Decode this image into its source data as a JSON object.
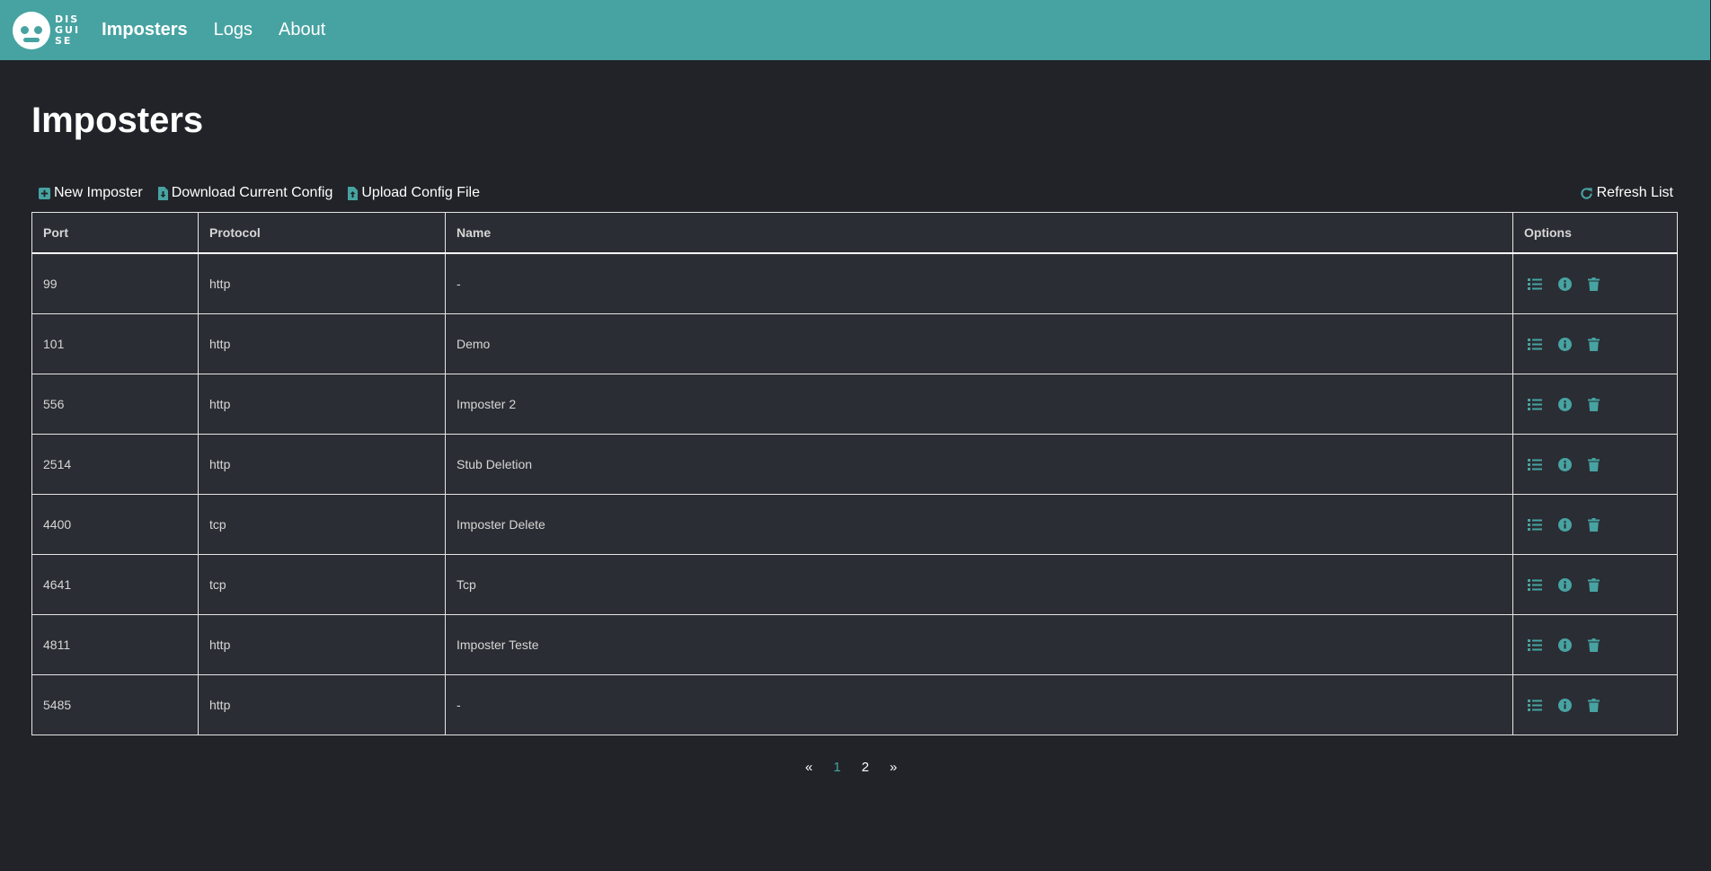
{
  "app": {
    "logo_text": [
      "DIS",
      "GUI",
      "SE"
    ],
    "brand_color": "#47a3a2",
    "background": "#212328"
  },
  "nav": {
    "items": [
      {
        "label": "Imposters",
        "active": true
      },
      {
        "label": "Logs",
        "active": false
      },
      {
        "label": "About",
        "active": false
      }
    ]
  },
  "page": {
    "title": "Imposters"
  },
  "toolbar": {
    "new_label": "New Imposter",
    "new_icon": "plus-square-icon",
    "download_label": "Download Current Config",
    "download_icon": "file-download-icon",
    "upload_label": "Upload Config File",
    "upload_icon": "file-upload-icon",
    "refresh_label": "Refresh List",
    "refresh_icon": "refresh-icon"
  },
  "table": {
    "headers": {
      "port": "Port",
      "protocol": "Protocol",
      "name": "Name",
      "options": "Options"
    },
    "option_icons": [
      "list-icon",
      "info-circle-icon",
      "trash-icon"
    ],
    "rows": [
      {
        "port": "99",
        "protocol": "http",
        "name": "-"
      },
      {
        "port": "101",
        "protocol": "http",
        "name": "Demo"
      },
      {
        "port": "556",
        "protocol": "http",
        "name": "Imposter 2"
      },
      {
        "port": "2514",
        "protocol": "http",
        "name": "Stub Deletion"
      },
      {
        "port": "4400",
        "protocol": "tcp",
        "name": "Imposter Delete"
      },
      {
        "port": "4641",
        "protocol": "tcp",
        "name": "Tcp"
      },
      {
        "port": "4811",
        "protocol": "http",
        "name": "Imposter Teste"
      },
      {
        "port": "5485",
        "protocol": "http",
        "name": "-"
      }
    ]
  },
  "pagination": {
    "prev": "«",
    "pages": [
      "1",
      "2"
    ],
    "current": "1",
    "next": "»"
  }
}
